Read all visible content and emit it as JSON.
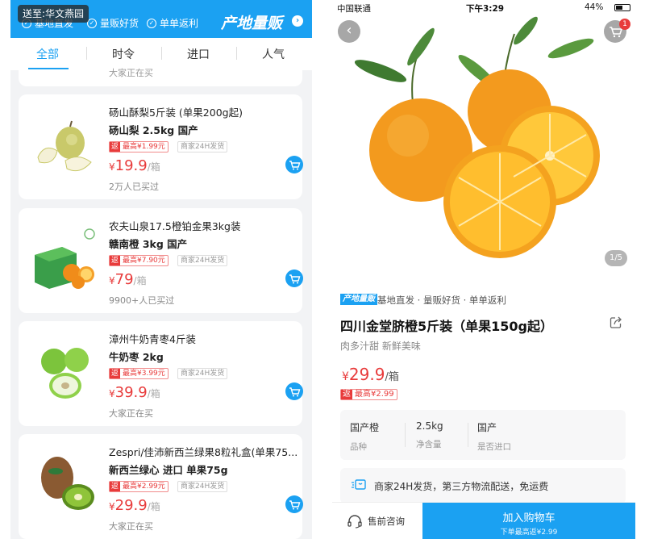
{
  "left": {
    "location_label": "送至:华文燕园",
    "banner_tags": [
      "基地直发",
      "量贩好货",
      "单单返利"
    ],
    "brand": "产地量贩",
    "tabs": [
      "全部",
      "时令",
      "进口",
      "人气"
    ],
    "cut_text": "大家正在买",
    "products": [
      {
        "name": "砀山酥梨5斤装 (单果200g起)",
        "spec": "砀山梨  2.5kg  国产",
        "rebate_key": "返",
        "rebate_value": "最高¥1.99元",
        "ship": "商家24H发货",
        "price_symbol": "¥",
        "price": "19.9",
        "unit": "/箱",
        "sold": "2万人已买过",
        "icon": "pear-image"
      },
      {
        "name": "农夫山泉17.5橙铂金果3kg装",
        "spec": "赣南橙  3kg  国产",
        "rebate_key": "返",
        "rebate_value": "最高¥7.90元",
        "ship": "商家24H发货",
        "price_symbol": "¥",
        "price": "79",
        "unit": "/箱",
        "sold": "9900+人已买过",
        "icon": "orange-box-image"
      },
      {
        "name": "漳州牛奶青枣4斤装",
        "spec": "牛奶枣  2kg",
        "rebate_key": "返",
        "rebate_value": "最高¥3.99元",
        "ship": "商家24H发货",
        "price_symbol": "¥",
        "price": "39.9",
        "unit": "/箱",
        "sold": "大家正在买",
        "icon": "jujube-image"
      },
      {
        "name": "Zespri/佳沛新西兰绿果8粒礼盒(单果75...",
        "spec": "新西兰绿心  进口  单果75g",
        "rebate_key": "返",
        "rebate_value": "最高¥2.99元",
        "ship": "商家24H发货",
        "price_symbol": "¥",
        "price": "29.9",
        "unit": "/箱",
        "sold": "大家正在买",
        "icon": "kiwi-image"
      }
    ]
  },
  "right": {
    "status": {
      "carrier": "中国联通",
      "time": "下午3:29",
      "battery": "44%"
    },
    "cart_badge": "1",
    "page_indicator": "1/5",
    "brand": "产地量贩",
    "tags": "基地直发 · 量贩好货 · 单单返利",
    "title": "四川金堂脐橙5斤装（单果150g起）",
    "subtitle": "肉多汁甜 新鲜美味",
    "price_symbol": "¥",
    "price": "29.9",
    "unit": "/箱",
    "rebate_key": "返",
    "rebate_value": "最高¥2.99",
    "attrs": [
      {
        "value": "国产橙",
        "key": "品种"
      },
      {
        "value": "2.5kg",
        "key": "净含量"
      },
      {
        "value": "国产",
        "key": "是否进口"
      }
    ],
    "delivery": "商家24H发货，第三方物流配送，免运费",
    "consult": "售前咨询",
    "add_cart": "加入购物车",
    "add_cart_sub": "下单最高返¥2.99"
  },
  "colors": {
    "accent": "#1ba1f2",
    "price": "#e83b3b"
  }
}
